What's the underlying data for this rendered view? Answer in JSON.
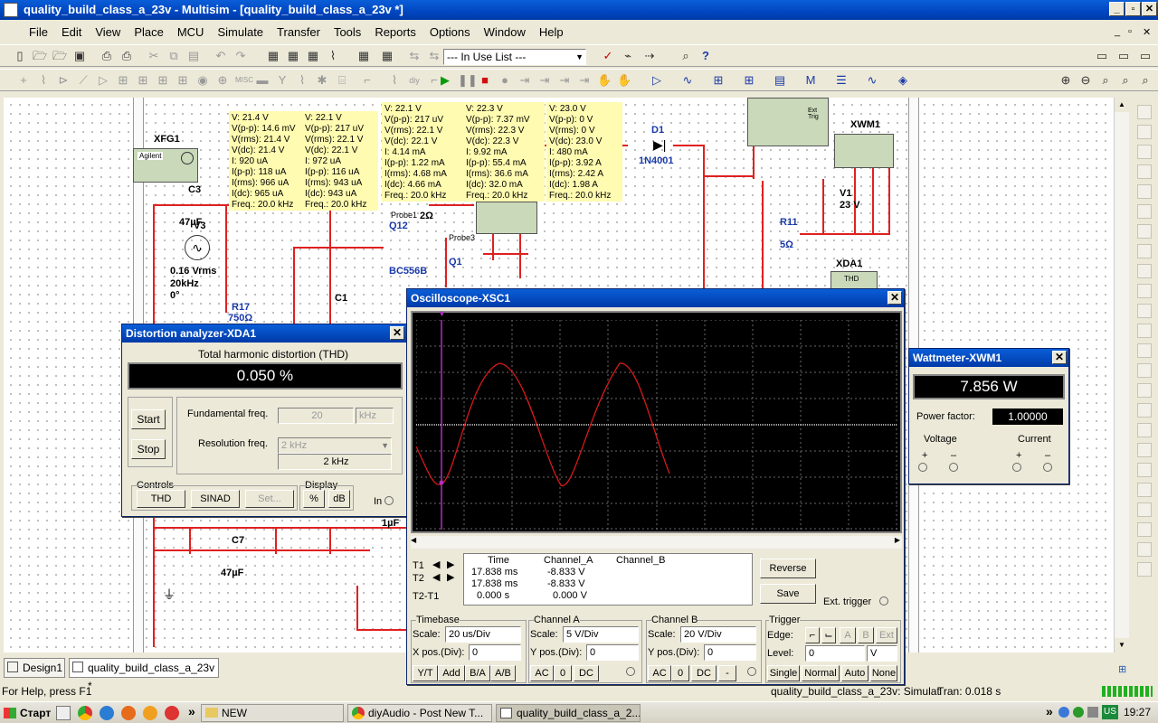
{
  "app": {
    "title": "quality_build_class_a_23v - Multisim - [quality_build_class_a_23v *]"
  },
  "menu": [
    "File",
    "Edit",
    "View",
    "Place",
    "MCU",
    "Simulate",
    "Transfer",
    "Tools",
    "Reports",
    "Options",
    "Window",
    "Help"
  ],
  "toolbar": {
    "in_use_list": "--- In Use List ---"
  },
  "probes": [
    "V: 21.4 V\nV(p-p): 14.6 mV\nV(rms): 21.4 V\nV(dc): 21.4 V\nI: 920 uA\nI(p-p): 118 uA\nI(rms): 966 uA\nI(dc): 965 uA\nFreq.: 20.0 kHz",
    "V: 22.1 V\nV(p-p): 217 uV\nV(rms): 22.1 V\nV(dc): 22.1 V\nI: 972 uA\nI(p-p): 116 uA\nI(rms): 943 uA\nI(dc): 943 uA\nFreq.: 20.0 kHz",
    "V: 22.1 V\nV(p-p): 217 uV\nV(rms): 22.1 V\nV(dc): 22.1 V\nI: 4.14 mA\nI(p-p): 1.22 mA\nI(rms): 4.68 mA\nI(dc): 4.66 mA\nFreq.: 20.0 kHz",
    "V: 22.3 V\nV(p-p): 7.37 mV\nV(rms): 22.3 V\nV(dc): 22.3 V\nI: 9.92 mA\nI(p-p): 55.4 mA\nI(rms): 36.6 mA\nI(dc): 32.0 mA\nFreq.: 20.0 kHz",
    "V: 23.0 V\nV(p-p): 0 V\nV(rms): 0 V\nV(dc): 23.0 V\nI: 480 mA\nI(p-p): 3.92 A\nI(rms): 2.42 A\nI(dc): 1.98 A\nFreq.: 20.0 kHz"
  ],
  "components": {
    "xfg1": "XFG1",
    "agilent": "Agilent",
    "c3": "C3",
    "c3_val": "47µF",
    "v3": "V3",
    "v3_vrms": "0.16 Vrms",
    "v3_freq": "20kHz",
    "v3_phase": "0°",
    "r17": "R17",
    "r17_val": "750Ω",
    "c1": "C1",
    "c7": "C7",
    "c7_val": "47µF",
    "c_1uf": "1µF",
    "q12": "Q12",
    "q12_model": "BC556B",
    "q1": "Q1",
    "probe1": "Probe1",
    "probe3": "Probe3",
    "r_partial": "2Ω",
    "d1": "D1",
    "d1_model": "1N4001",
    "xwm1": "XWM1",
    "v1": "V1",
    "v1_val": "23 V",
    "r11": "R11",
    "r11_val": "5Ω",
    "xda1": "XDA1",
    "ext_trig": "Ext Trig",
    "thd_small": "THD"
  },
  "distortion": {
    "title": "Distortion analyzer-XDA1",
    "heading": "Total harmonic distortion (THD)",
    "value": "0.050 %",
    "start": "Start",
    "stop": "Stop",
    "fund_label": "Fundamental freq.",
    "fund_value": "20",
    "fund_unit": "kHz",
    "res_label": "Resolution freq.",
    "res_value": "2 kHz",
    "res_display": "2 kHz",
    "controls_label": "Controls",
    "thd": "THD",
    "sinad": "SINAD",
    "set": "Set...",
    "display_label": "Display",
    "pct": "%",
    "db": "dB",
    "in": "In"
  },
  "oscilloscope": {
    "title": "Oscilloscope-XSC1",
    "headers": [
      "Time",
      "Channel_A",
      "Channel_B"
    ],
    "rows": [
      {
        "label": "T1",
        "time": "17.838 ms",
        "a": "-8.833 V",
        "b": ""
      },
      {
        "label": "T2",
        "time": "17.838 ms",
        "a": "-8.833 V",
        "b": ""
      },
      {
        "label": "T2-T1",
        "time": "0.000 s",
        "a": "0.000 V",
        "b": ""
      }
    ],
    "reverse": "Reverse",
    "save": "Save",
    "ext_trigger": "Ext. trigger",
    "timebase": {
      "label": "Timebase",
      "scale_label": "Scale:",
      "scale": "20 us/Div",
      "xpos_label": "X pos.(Div):",
      "xpos": "0",
      "yt": "Y/T",
      "add": "Add",
      "ba": "B/A",
      "ab": "A/B"
    },
    "channel_a": {
      "label": "Channel A",
      "scale_label": "Scale:",
      "scale": "5  V/Div",
      "ypos_label": "Y pos.(Div):",
      "ypos": "0",
      "ac": "AC",
      "zero": "0",
      "dc": "DC"
    },
    "channel_b": {
      "label": "Channel B",
      "scale_label": "Scale:",
      "scale": "20  V/Div",
      "ypos_label": "Y pos.(Div):",
      "ypos": "0",
      "ac": "AC",
      "zero": "0",
      "dc": "DC",
      "minus": "-"
    },
    "trigger": {
      "label": "Trigger",
      "edge_label": "Edge:",
      "a": "A",
      "b": "B",
      "ext": "Ext",
      "level_label": "Level:",
      "level": "0",
      "unit": "V",
      "single": "Single",
      "normal": "Normal",
      "auto": "Auto",
      "none": "None"
    }
  },
  "wattmeter": {
    "title": "Wattmeter-XWM1",
    "value": "7.856 W",
    "pf_label": "Power factor:",
    "pf_value": "1.00000",
    "voltage": "Voltage",
    "current": "Current",
    "plus": "+",
    "minus": "–"
  },
  "tabs": {
    "design1": "Design1",
    "doc": "quality_build_class_a_23v *"
  },
  "status": {
    "help": "For Help, press F1",
    "sim": "quality_build_class_a_23v: Simulat",
    "tran": "Tran: 0.018 s"
  },
  "taskbar": {
    "start": "Старт",
    "items": [
      "NEW",
      "diyAudio - Post New T...",
      "quality_build_class_a_2..."
    ],
    "lang": "US",
    "time": "19:27",
    "chevron": "»"
  },
  "colors": {
    "wire": "#e02020",
    "probe_bg": "#fffbb0",
    "scope_trace": "#d41a1a",
    "titlebar": "#0a5ed8"
  }
}
